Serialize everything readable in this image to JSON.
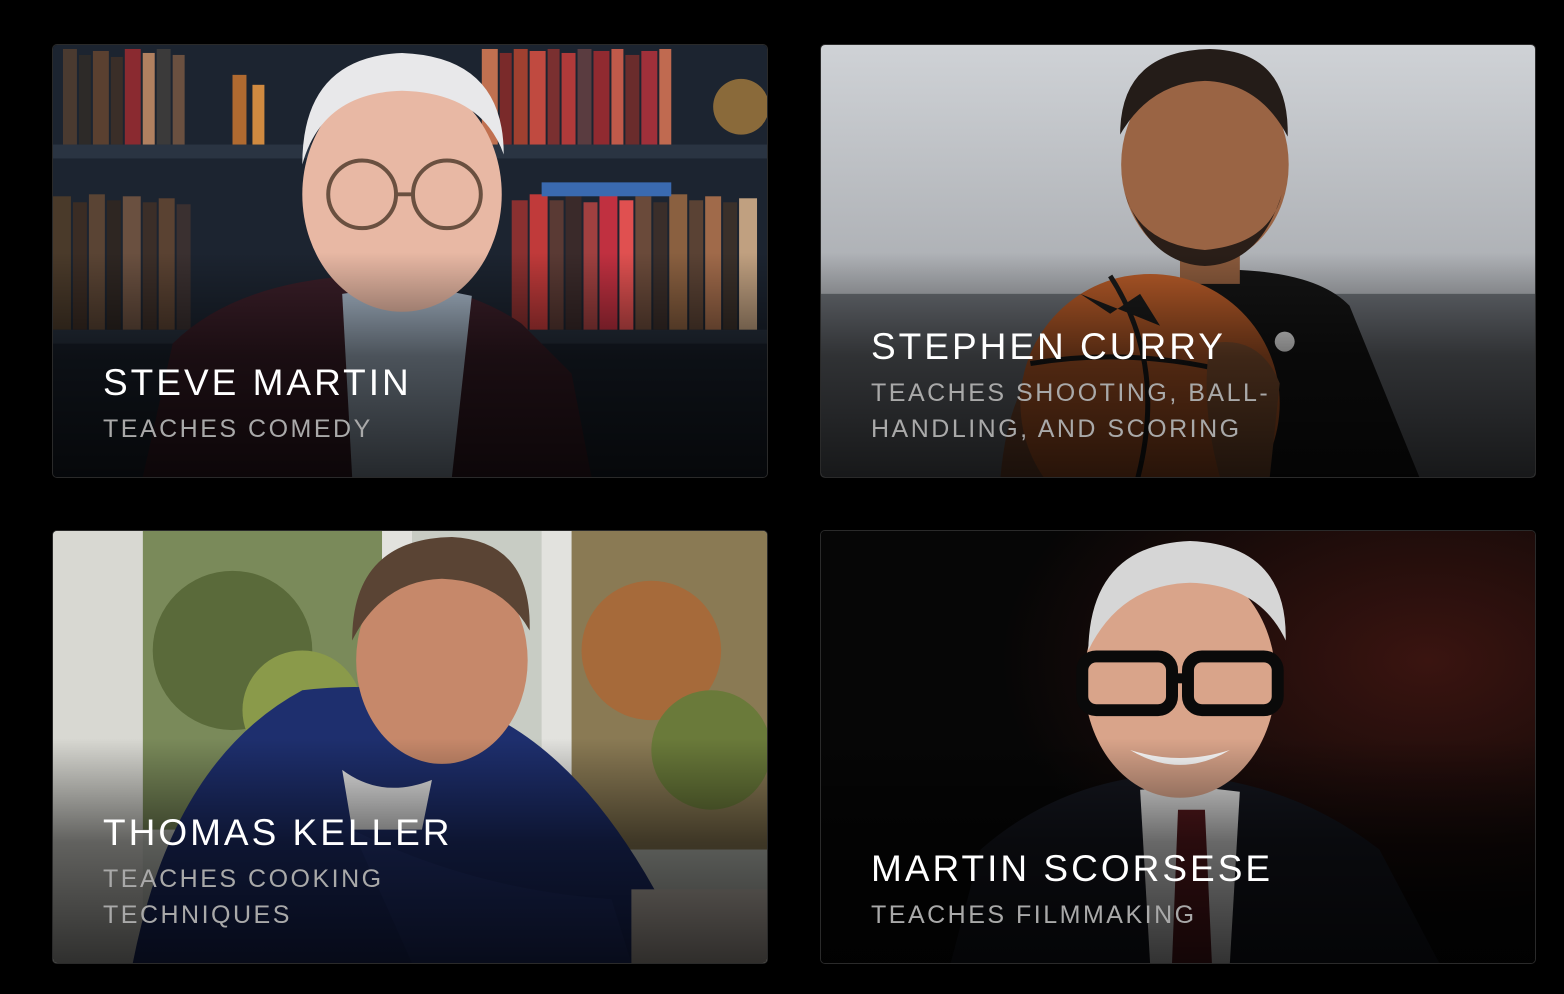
{
  "instructors": [
    {
      "name": "STEVE MARTIN",
      "subtitle": "TEACHES COMEDY",
      "image": "steve-martin-portrait"
    },
    {
      "name": "STEPHEN CURRY",
      "subtitle": "TEACHES SHOOTING, BALL-HANDLING, AND SCORING",
      "image": "stephen-curry-portrait"
    },
    {
      "name": "THOMAS KELLER",
      "subtitle": "TEACHES COOKING TECHNIQUES",
      "image": "thomas-keller-portrait"
    },
    {
      "name": "MARTIN SCORSESE",
      "subtitle": "TEACHES FILMMAKING",
      "image": "martin-scorsese-portrait"
    }
  ],
  "colors": {
    "background": "#000000",
    "name_text": "#ffffff",
    "subtitle_text": "#a9a9a9"
  }
}
